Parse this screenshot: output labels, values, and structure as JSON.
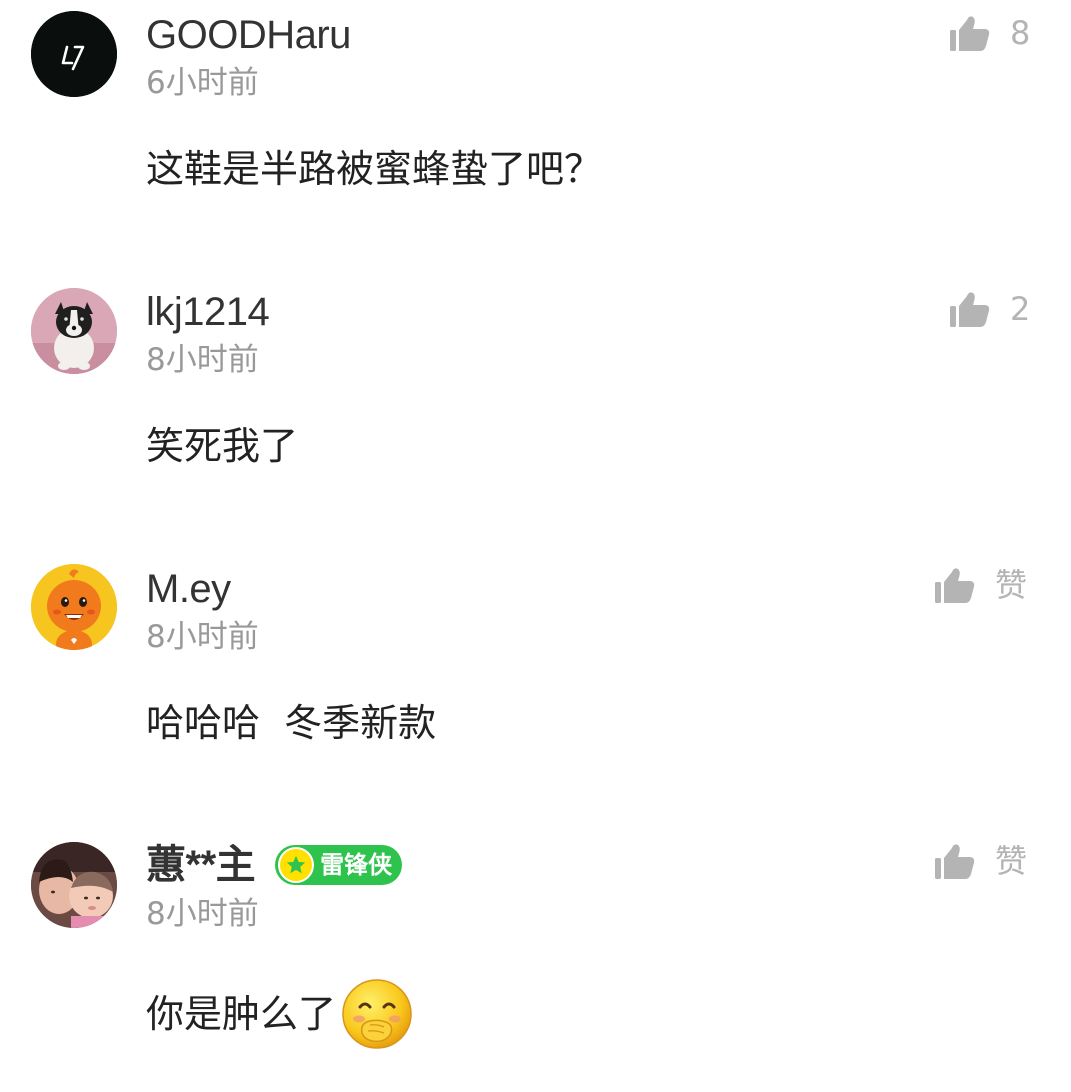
{
  "comments": [
    {
      "username": "GOODHaru",
      "time": "6小时前",
      "text": "这鞋是半路被蜜蜂蛰了吧？",
      "like_label": "8",
      "avatar": "logo-avatar",
      "colors": {
        "avatar_bg": "#0a0f0e"
      }
    },
    {
      "username": "lkj1214",
      "time": "8小时前",
      "text": "笑死我了",
      "like_label": "2",
      "avatar": "puppy-photo-avatar",
      "colors": {
        "avatar_bg": "#d9a7b6"
      }
    },
    {
      "username": "M.ey",
      "time": "8小时前",
      "text": "哈哈哈  冬季新款",
      "like_label": "赞",
      "avatar": "orange-cartoon-avatar",
      "colors": {
        "avatar_bg": "#f7c520"
      }
    },
    {
      "username": "蕙**主",
      "time": "8小时前",
      "text": "你是肿么了",
      "like_label": "赞",
      "avatar": "family-photo-avatar",
      "badge": "雷锋侠",
      "emoji": "covering-mouth-emoji",
      "colors": {
        "badge": "#2ec34c",
        "badge_star": "#ffe000"
      }
    }
  ],
  "icons": {
    "like": "thumbs-up-icon",
    "badge_star": "star-icon"
  },
  "colors": {
    "username": "#333333",
    "timestamp": "#999999",
    "content": "#222222",
    "like": "#b4b4b4"
  }
}
